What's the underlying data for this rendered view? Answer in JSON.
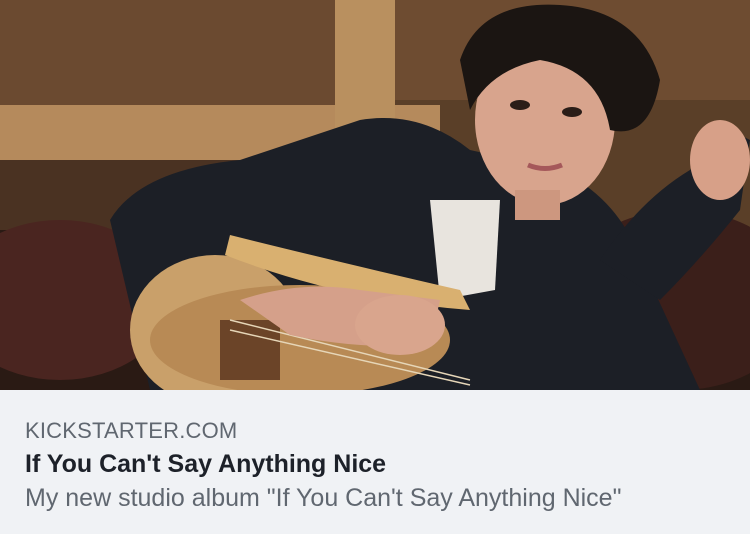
{
  "link_preview": {
    "domain": "KICKSTARTER.COM",
    "title": "If You Can't Say Anything Nice",
    "description": "My new studio album \"If You Can't Say Anything Nice\""
  },
  "colors": {
    "caption_background": "#f0f2f5",
    "title_text": "#1d2129",
    "secondary_text": "#606770"
  }
}
